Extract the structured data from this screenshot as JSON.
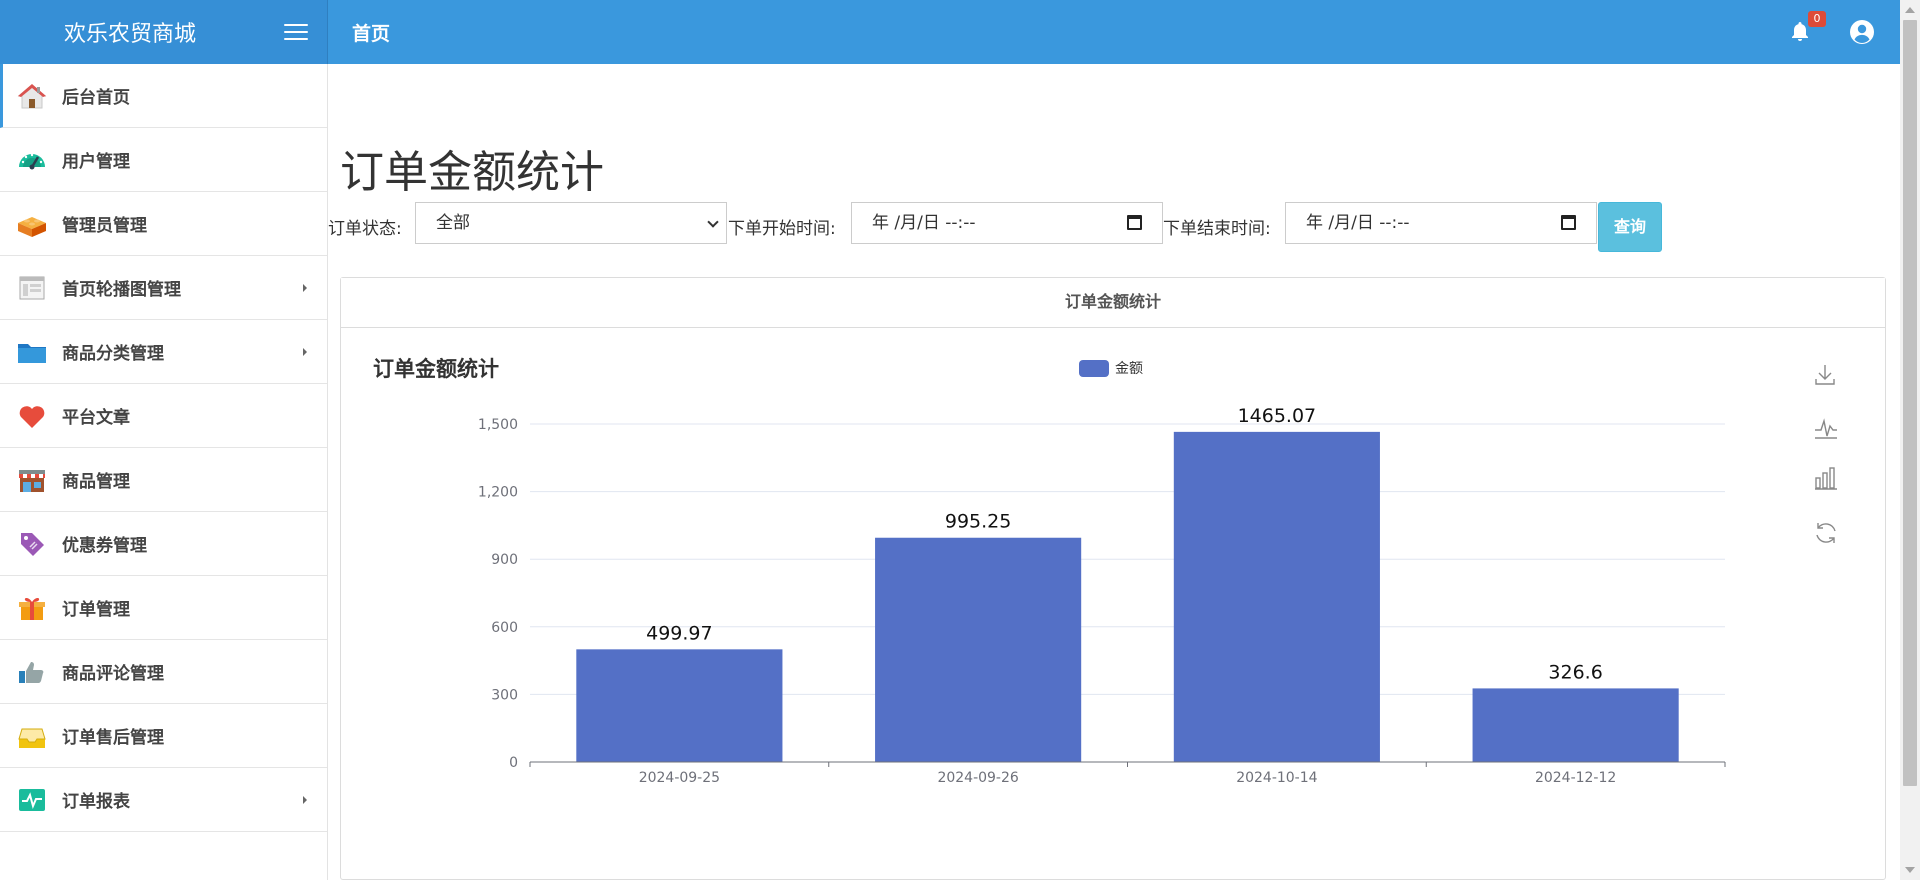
{
  "app": {
    "title": "欢乐农贸商城",
    "page_title": "首页"
  },
  "header": {
    "notification_count": "0",
    "icons": [
      "menu-icon",
      "bell-icon",
      "user-circle-icon"
    ]
  },
  "sidebar": {
    "items": [
      {
        "label": "后台首页",
        "icon": "home-icon",
        "has_arrow": false,
        "active": true
      },
      {
        "label": "用户管理",
        "icon": "dashboard-gauge-icon",
        "has_arrow": false
      },
      {
        "label": "管理员管理",
        "icon": "lego-brick-icon",
        "has_arrow": false
      },
      {
        "label": "首页轮播图管理",
        "icon": "window-layout-icon",
        "has_arrow": true
      },
      {
        "label": "商品分类管理",
        "icon": "folder-icon",
        "has_arrow": true
      },
      {
        "label": "平台文章",
        "icon": "heart-icon",
        "has_arrow": false
      },
      {
        "label": "商品管理",
        "icon": "store-icon",
        "has_arrow": false
      },
      {
        "label": "优惠券管理",
        "icon": "tag-icon",
        "has_arrow": false
      },
      {
        "label": "订单管理",
        "icon": "gift-icon",
        "has_arrow": false
      },
      {
        "label": "商品评论管理",
        "icon": "thumbs-up-icon",
        "has_arrow": false
      },
      {
        "label": "订单售后管理",
        "icon": "inbox-tray-icon",
        "has_arrow": false
      },
      {
        "label": "订单报表",
        "icon": "activity-pulse-icon",
        "has_arrow": true
      }
    ]
  },
  "main": {
    "heading": "订单金额统计",
    "filters": {
      "status_label": "订单状态:",
      "status_value": "全部",
      "start_label": "下单开始时间:",
      "start_value": "年 /月/日 --:--",
      "end_label": "下单结束时间:",
      "end_value": "年 /月/日 --:--",
      "query_button": "查询"
    },
    "panel_title": "订单金额统计"
  },
  "colors": {
    "header_blue": "#3a98dd",
    "bar_color": "#5470c6",
    "query_button": "#5bc0de",
    "badge_red": "#dd4b39"
  },
  "chart_data": {
    "type": "bar",
    "title": "订单金额统计",
    "legend": [
      "金额"
    ],
    "legend_placement": "top-center",
    "categories": [
      "2024-09-25",
      "2024-09-26",
      "2024-10-14",
      "2024-12-12"
    ],
    "series": [
      {
        "name": "金额",
        "values": [
          499.97,
          995.25,
          1465.07,
          326.6
        ]
      }
    ],
    "data_labels": [
      "499.97",
      "995.25",
      "1465.07",
      "326.6"
    ],
    "ylim": [
      0,
      1500
    ],
    "yticks": [
      0,
      300,
      600,
      900,
      1200,
      1500
    ],
    "ytick_labels": [
      "0",
      "300",
      "600",
      "900",
      "1,200",
      "1,500"
    ],
    "grid": true,
    "toolbox": [
      "download-icon",
      "line-chart-icon",
      "bar-chart-icon",
      "refresh-icon"
    ]
  }
}
